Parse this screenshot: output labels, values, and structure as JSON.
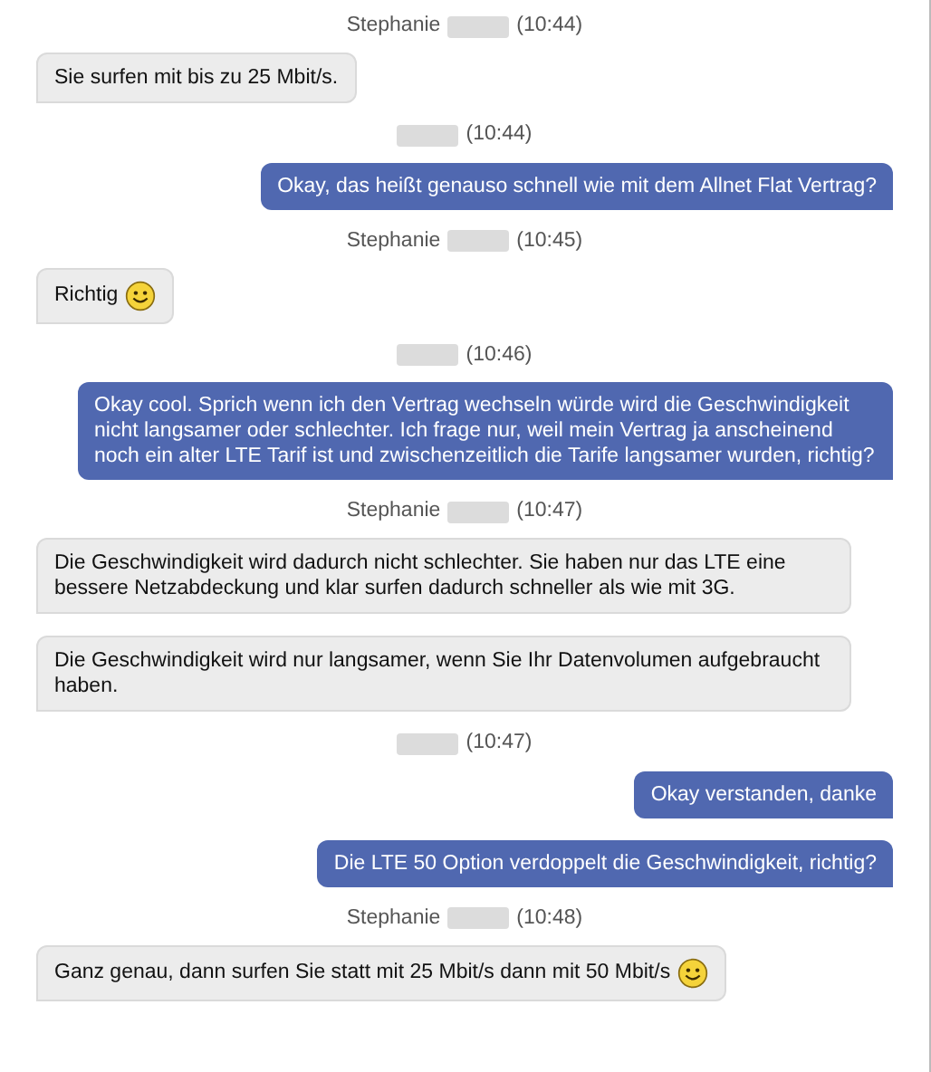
{
  "groups": [
    {
      "kind": "incoming",
      "sender": "Stephanie",
      "time": "(10:44)",
      "messages": [
        {
          "text": "Sie surfen mit bis zu 25 Mbit/s.",
          "smiley": false
        }
      ]
    },
    {
      "kind": "outgoing",
      "time": "(10:44)",
      "messages": [
        {
          "text": "Okay, das heißt genauso schnell wie mit dem Allnet Flat Vertrag?",
          "smiley": false
        }
      ]
    },
    {
      "kind": "incoming",
      "sender": "Stephanie",
      "time": "(10:45)",
      "messages": [
        {
          "text": "Richtig",
          "smiley": true
        }
      ]
    },
    {
      "kind": "outgoing",
      "time": "(10:46)",
      "messages": [
        {
          "text": "Okay cool. Sprich wenn ich den Vertrag wechseln würde wird die Geschwindigkeit nicht langsamer oder schlechter. Ich frage nur, weil mein Vertrag ja anscheinend noch ein alter LTE Tarif ist und zwischenzeitlich die Tarife langsamer wurden, richtig?",
          "smiley": false
        }
      ]
    },
    {
      "kind": "incoming",
      "sender": "Stephanie",
      "time": "(10:47)",
      "messages": [
        {
          "text": "Die Geschwindigkeit wird dadurch nicht schlechter. Sie haben nur das LTE eine bessere Netzabdeckung und klar surfen dadurch schneller als wie mit 3G.",
          "smiley": false
        },
        {
          "text": "Die Geschwindigkeit wird nur langsamer, wenn Sie Ihr Datenvolumen aufgebraucht haben.",
          "smiley": false
        }
      ]
    },
    {
      "kind": "outgoing",
      "time": "(10:47)",
      "messages": [
        {
          "text": "Okay verstanden, danke",
          "smiley": false
        },
        {
          "text": "Die LTE 50 Option verdoppelt die Geschwindigkeit, richtig?",
          "smiley": false
        }
      ]
    },
    {
      "kind": "incoming",
      "sender": "Stephanie",
      "time": "(10:48)",
      "messages": [
        {
          "text": "Ganz genau, dann surfen Sie statt mit 25 Mbit/s dann mit 50 Mbit/s",
          "smiley": true
        }
      ]
    }
  ]
}
